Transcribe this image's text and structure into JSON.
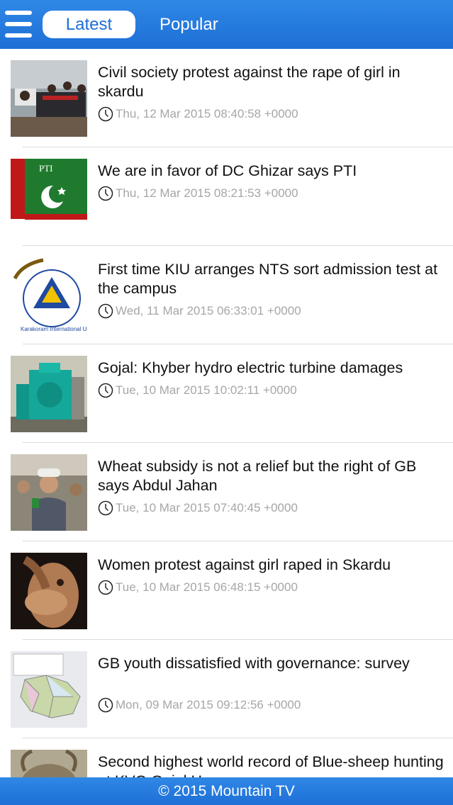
{
  "header": {
    "menu_icon": "hamburger-menu-icon",
    "tabs": [
      {
        "label": "Latest",
        "active": true
      },
      {
        "label": "Popular",
        "active": false
      }
    ]
  },
  "articles": [
    {
      "title": "Civil society protest against the rape of girl in skardu",
      "date": "Thu, 12 Mar 2015 08:40:58 +0000"
    },
    {
      "title": "We are in favor of DC Ghizar says PTI",
      "date": "Thu, 12 Mar 2015 08:21:53 +0000",
      "thumb_text": "PTI"
    },
    {
      "title": "First time KIU arranges NTS sort admission test at the campus",
      "date": "Wed, 11 Mar 2015 06:33:01 +0000",
      "thumb_text": "Karakoram International University"
    },
    {
      "title": "Gojal: Khyber hydro electric turbine damages",
      "date": "Tue, 10 Mar 2015 10:02:11 +0000"
    },
    {
      "title": "Wheat subsidy is not a relief but the right of GB says Abdul Jahan",
      "date": "Tue, 10 Mar 2015 07:40:45 +0000"
    },
    {
      "title": "Women protest against girl raped in Skardu",
      "date": "Tue, 10 Mar 2015 06:48:15 +0000"
    },
    {
      "title": "GB youth dissatisfied with governance: survey",
      "date": "Mon, 09 Mar 2015 09:12:56 +0000"
    },
    {
      "title": "Second highest world record of Blue-sheep hunting at KVO Gojal H...",
      "date": ""
    }
  ],
  "footer": {
    "text": "© 2015 Mountain TV"
  },
  "colors": {
    "bar": "#1e6fd6",
    "date": "#a6a6a6"
  }
}
